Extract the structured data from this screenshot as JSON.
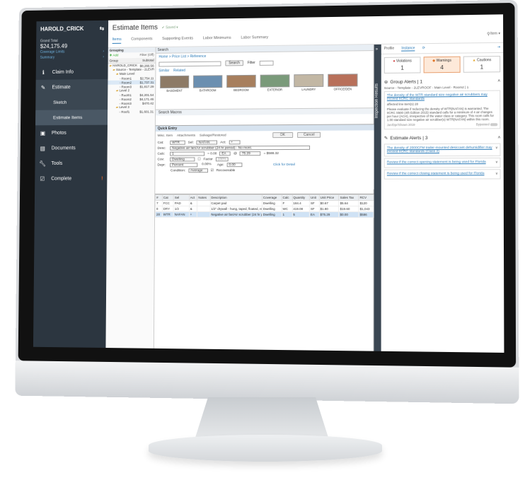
{
  "nav": {
    "user": "HAROLD_CRICK",
    "grand_total_label": "Grand Total",
    "grand_total_value": "$24,175.49",
    "coverage_limits": "Coverage Limits",
    "summary": "Summary",
    "items": [
      {
        "label": "Claim Info",
        "icon": "info-icon"
      },
      {
        "label": "Estimate",
        "icon": "wrench-pen-icon"
      },
      {
        "label": "Sketch"
      },
      {
        "label": "Estimate Items"
      },
      {
        "label": "Photos",
        "icon": "photo-icon"
      },
      {
        "label": "Documents",
        "icon": "documents-icon"
      },
      {
        "label": "Tools",
        "icon": "wrench-icon"
      },
      {
        "label": "Complete",
        "icon": "check-icon",
        "flag": "!"
      }
    ]
  },
  "header": {
    "title": "Estimate Items",
    "saved": "Saved",
    "tabs": [
      "Items",
      "Components",
      "Supporting Events",
      "Labor Minimums",
      "Labor Summary"
    ],
    "item_button": "Item"
  },
  "grouping": {
    "title": "Grouping",
    "add": "Add",
    "filter": "Filter (Off)",
    "col_group": "Group",
    "col_subtotal": "Subtotal",
    "rows": [
      {
        "label": "HAROLD_CRICK",
        "value": "$8,266.56",
        "indent": 0,
        "kind": "folder"
      },
      {
        "label": "Source - Template - 2LEVROOF",
        "value": "",
        "indent": 1,
        "kind": "folder"
      },
      {
        "label": "Main Level",
        "value": "",
        "indent": 2,
        "kind": "folder"
      },
      {
        "label": "Room1",
        "value": "$2,754.11",
        "indent": 3,
        "kind": "doc"
      },
      {
        "label": "Room2",
        "value": "$1,737.31",
        "indent": 3,
        "kind": "doc",
        "selected": true
      },
      {
        "label": "Room3",
        "value": "$1,817.29",
        "indent": 3,
        "kind": "doc"
      },
      {
        "label": "Level 2",
        "value": "",
        "indent": 2,
        "kind": "folder"
      },
      {
        "label": "Room1",
        "value": "$4,201.54",
        "indent": 3,
        "kind": "doc"
      },
      {
        "label": "Room2",
        "value": "$4,171.46",
        "indent": 3,
        "kind": "doc"
      },
      {
        "label": "Room3",
        "value": "$470.42",
        "indent": 3,
        "kind": "doc"
      },
      {
        "label": "Level 3",
        "value": "",
        "indent": 2,
        "kind": "folder"
      },
      {
        "label": "Roof1",
        "value": "$1,601.31",
        "indent": 3,
        "kind": "doc"
      }
    ]
  },
  "search": {
    "title": "Search",
    "breadcrumb": "Home > Price List > Reference",
    "search_button": "Search",
    "filter_label": "Filter",
    "similar_tabs": [
      "Similar",
      "Related"
    ],
    "thumbnails": [
      "BASEMENT",
      "BATHROOM",
      "BEDROOM",
      "EXTERIOR",
      "LAUNDRY",
      "OFFICE/DEN"
    ],
    "thumb_colors": [
      "#8d7a66",
      "#6b8fb0",
      "#a77f5e",
      "#7a9a7a",
      "#c2b7a4",
      "#b8705a"
    ],
    "bottom_tabs": "Search  Macros"
  },
  "quick_entry": {
    "title": "Quick Entry",
    "tabs": [
      "Misc. Item",
      "Attachments",
      "Salvage/Restored"
    ],
    "ok": "OK",
    "cancel": "Cancel",
    "cat_label": "Cat:",
    "cat_value": "WTR",
    "sel_label": "Sel:",
    "sel_value": "NAFAN",
    "act_label": "Act:",
    "act_value": "+",
    "desc_label": "Desc:",
    "desc_value": "Negative air fan/Air scrubber (24 hr period) - No mont.",
    "calc_label": "Calc:",
    "calc_value": "1",
    "calc_eq": "= 0.00",
    "unit": "EA",
    "price": "75.29",
    "total": "= $588.32",
    "cov_label": "Cov:",
    "cov_value": "Dwelling",
    "factor_label": "Factor",
    "factor_value": "100%",
    "depr_label": "Depr:",
    "depr_value": "Percent",
    "depr_pct": "0.00%",
    "age_label": "Age:",
    "age_value": "0.00",
    "condition_label": "Condition:",
    "condition_value": "Average",
    "recoverable": "Recoverable",
    "click_details": "Click for Detail"
  },
  "grid": {
    "headers": [
      "#",
      "Cat",
      "Sel",
      "Act",
      "Notes",
      "Description",
      "Coverage",
      "Calc",
      "Quantity",
      "Unit",
      "Unit Price",
      "Sales Tax",
      "RCV"
    ],
    "rows": [
      {
        "cells": [
          "7",
          "FCC",
          "PAD",
          "&",
          "",
          "Carpet pad",
          "Dwelling",
          "F",
          "184.4",
          "SF",
          "$0.67",
          "$5.64",
          "$120"
        ]
      },
      {
        "cells": [
          "8",
          "DRY",
          "1/2",
          "&",
          "",
          "1/2\" drywall - hung, taped, floated, ready for p",
          "Dwelling",
          "WC",
          "419.08",
          "SF",
          "$1.80",
          "$19.60",
          "$1,043"
        ]
      },
      {
        "cells": [
          "28",
          "WTR",
          "NAFAN",
          "+",
          "",
          "Negative air fan/Air scrubber (24 hr period) - Y",
          "Dwelling",
          "1",
          "5",
          "EA",
          "$75.29",
          "$0.00",
          "$586"
        ],
        "selected": true
      }
    ]
  },
  "right_panel": {
    "side_label": "Inspection Results",
    "tabs": [
      "Profile",
      "Instance"
    ],
    "counters": [
      {
        "label": "Violations",
        "value": "1"
      },
      {
        "label": "Warnings",
        "value": "4"
      },
      {
        "label": "Cautions",
        "value": "1"
      }
    ],
    "group_alerts_title": "Group Alerts | 1",
    "group_path": "Source - Template - 2LEVROOF - Main Level - Room2 | 1",
    "group_alert": {
      "link": "The density of the WTR standard size negative air scrubbers may exceed IICRC standards",
      "affected": "affected line item(s) 28",
      "body": "Please evaluate if reducing the density of WTR(NAFAN) is warranted. The IICRC S500 (4th Edition 2015) standard calls for a minimum of 4 air changes per hour (ACH), irrespective of the water class or category. This room calls for 1.00 standard size negative air scrubber(s) WTR(NAFAN) within this room.",
      "date": "Jan/Dpr/Shown 2019",
      "bypassed": "Bypassed"
    },
    "estimate_alerts_title": "Estimate Alerts | 3",
    "estimate_alerts": [
      "The density of 2000CFM trailer-mounted desiccant dehumidifier may exceed IICRC standards (Class 2)",
      "Review if the correct opening statement is being used for Florida",
      "Review if the correct closing statement is being used for Florida"
    ]
  }
}
